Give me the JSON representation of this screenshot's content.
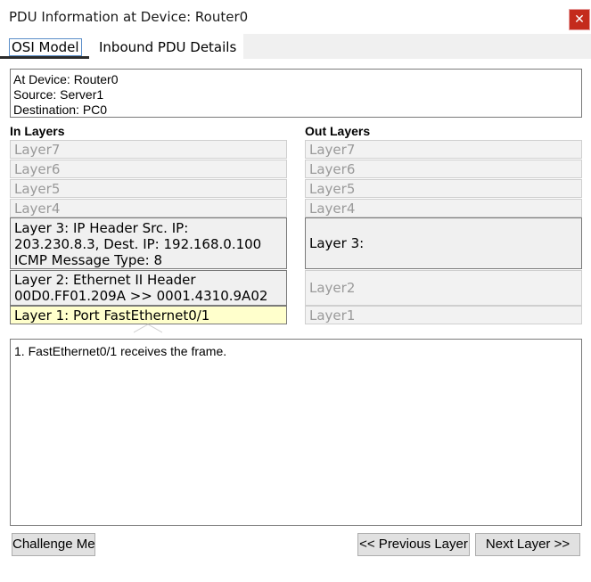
{
  "window": {
    "title": "PDU Information at Device: Router0",
    "close_glyph": "✕"
  },
  "tabs": [
    {
      "label": "OSI Model",
      "selected": true
    },
    {
      "label": "Inbound PDU Details",
      "selected": false
    }
  ],
  "info": {
    "device": "At Device: Router0",
    "source": "Source: Server1",
    "destination": "Destination: PC0"
  },
  "in_layers": {
    "heading": "In Layers",
    "l7": "Layer7",
    "l6": "Layer6",
    "l5": "Layer5",
    "l4": "Layer4",
    "l3": "Layer 3: IP Header Src. IP:\n203.230.8.3, Dest. IP: 192.168.0.100\nICMP Message Type: 8",
    "l2": "Layer 2: Ethernet II Header\n00D0.FF01.209A >> 0001.4310.9A02",
    "l1": "Layer 1: Port FastEthernet0/1"
  },
  "out_layers": {
    "heading": "Out Layers",
    "l7": "Layer7",
    "l6": "Layer6",
    "l5": "Layer5",
    "l4": "Layer4",
    "l3": "Layer 3:",
    "l2": "Layer2",
    "l1": "Layer1"
  },
  "detail_text": "1. FastEthernet0/1 receives the frame.",
  "buttons": {
    "challenge": "Challenge Me",
    "previous": "<< Previous Layer",
    "next": "Next Layer >>"
  },
  "colors": {
    "highlight": "#ffffcc",
    "close": "#c42b1c"
  }
}
